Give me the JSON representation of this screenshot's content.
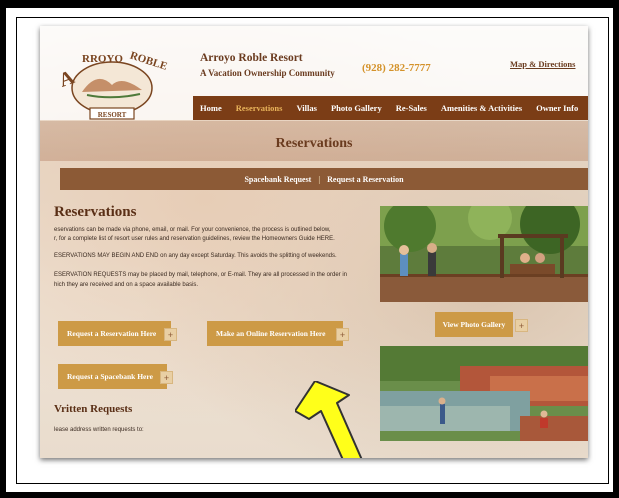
{
  "header": {
    "site_title": "Arroyo Roble Resort",
    "site_subtitle": "A Vacation Ownership Community",
    "phone": "(928) 282-7777",
    "map_link": "Map & Directions",
    "logo_text": "ARROYO ROBLE RESORT"
  },
  "nav": {
    "items": [
      {
        "label": "Home"
      },
      {
        "label": "Reservations"
      },
      {
        "label": "Villas"
      },
      {
        "label": "Photo Gallery"
      },
      {
        "label": "Re-Sales"
      },
      {
        "label": "Amenities & Activities"
      },
      {
        "label": "Owner Info"
      }
    ],
    "active": "Reservations"
  },
  "banner": {
    "title": "Reservations"
  },
  "subnav": {
    "items": [
      {
        "label": "Spacebank Request"
      },
      {
        "label": "Request a Reservation"
      }
    ],
    "separator": "|"
  },
  "main": {
    "heading": "Reservations",
    "paragraphs": [
      "eservations can be made via phone, email, or mail. For your convenience, the process is outlined below,",
      "r, for a complete list of resort user rules and reservation guidelines, review the Homeowners Guide HERE.",
      "ESERVATIONS MAY BEGIN AND END on any day except Saturday.  This avoids the splitting of weekends.",
      "ESERVATION REQUESTS may be placed by mail, telephone, or E-mail.  They are all processed in the order in",
      "hich they are received and on a space available basis."
    ],
    "buttons": {
      "request_reservation": "Request a Reservation Here",
      "online_reservation": "Make an Online Reservation Here",
      "spacebank": "Request a Spacebank Here",
      "plus": "+"
    },
    "written_heading": "Vritten Requests",
    "written_text": "lease address written requests to:"
  },
  "side": {
    "gallery_button": "View Photo Gallery",
    "plus": "+"
  },
  "colors": {
    "brown_dark": "#7b3d16",
    "brown_mid": "#8c5a36",
    "gold_button": "#cd9a46",
    "arrow_yellow": "#ffff1a"
  }
}
